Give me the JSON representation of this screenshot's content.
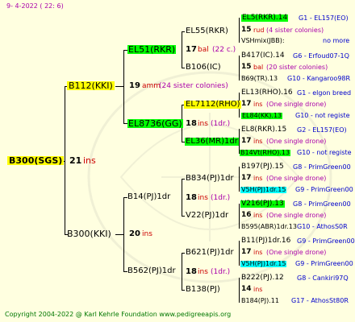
{
  "date": "9-  4-2022 ( 22:  6)",
  "copyright": "Copyright 2004-2022 @ Karl Kehrle Foundation   www.pedigreeapis.org",
  "root": {
    "name": "B300(SGS)",
    "num": "21",
    "status": "ins"
  },
  "gen1": [
    {
      "name": "B112(KKI)",
      "num": "19",
      "status": "amm",
      "extra": "(24 sister colonies)"
    },
    {
      "name": "B300(KKI)",
      "num": "20",
      "status": "ins"
    }
  ],
  "gen2": [
    {
      "name": "EL51(RKR)",
      "num": "17",
      "status": "bal",
      "extra": "(22 c.)"
    },
    {
      "name": "EL8736(GG)",
      "num": "18",
      "status": "ins",
      "extra": "(1dr.)"
    },
    {
      "name": "B14(PJ)1dr",
      "num": "18",
      "status": "ins",
      "extra": "(1dr.)"
    },
    {
      "name": "B562(PJ)1dr",
      "num": "18",
      "status": "ins",
      "extra": "(1dr.)"
    }
  ],
  "gen3": [
    {
      "name": "EL55(RKR)"
    },
    {
      "name": "B106(IC)"
    },
    {
      "name": "EL7112(RHO)"
    },
    {
      "name": "EL36(MR)1dr"
    },
    {
      "name": "B834(PJ)1dr"
    },
    {
      "name": "V22(PJ)1dr"
    },
    {
      "name": "B621(PJ)1dr"
    },
    {
      "name": "B138(PJ)"
    }
  ],
  "gen4": [
    {
      "name": "EL5(RKR).14",
      "info": "G1 - EL157(EO)",
      "num": "15",
      "status": "rud",
      "extra": "(4 sister colonies)",
      "breeder": "VSHmix(JBB):",
      "note": "no more"
    },
    {
      "name": "B417(IC).14",
      "info": "G6 - Erfoud07-1Q",
      "num": "15",
      "status": "bal",
      "extra": "(20 sister colonies)",
      "breeder": "B69(TR).13",
      "note": "G10 - Kangaroo98R"
    },
    {
      "name": "EL13(RHO).16",
      "info": "G1 - elgon breed",
      "num": "17",
      "status": "ins",
      "extra": "(One single drone)",
      "breeder": "EL84(KK).13",
      "note": "G10 - not registe"
    },
    {
      "name": "EL8(RKR).15",
      "info": "G2 - EL157(EO)",
      "num": "17",
      "status": "ins",
      "extra": "(One single drone)",
      "breeder": "B14Vt(RHO).13",
      "note": "G10 - not registe"
    },
    {
      "name": "B197(PJ).15",
      "info": "G8 - PrimGreen00",
      "num": "17",
      "status": "ins",
      "extra": "(One single drone)",
      "breeder": "V5H(PJ)1dr.15",
      "note": "G9 - PrimGreen00"
    },
    {
      "name": "V216(PJ).13",
      "info": "G8 - PrimGreen00",
      "num": "16",
      "status": "ins",
      "extra": "(One single drone)",
      "breeder": "B595(ABR)1dr.13",
      "note": "G10 - AthosS0R"
    },
    {
      "name": "B11(PJ)1dr.16",
      "info": "G9 - PrimGreen00",
      "num": "17",
      "status": "ins",
      "extra": "(One single drone)",
      "breeder": "V5H(PJ)1dr.15",
      "note": "G9 - PrimGreen00"
    },
    {
      "name": "B222(PJ).12",
      "info": "G8 - Cankiri97Q",
      "num": "14",
      "status": "ins",
      "extra": "",
      "breeder": "B184(PJ).11",
      "note": "G17 - AthosSt80R"
    }
  ]
}
